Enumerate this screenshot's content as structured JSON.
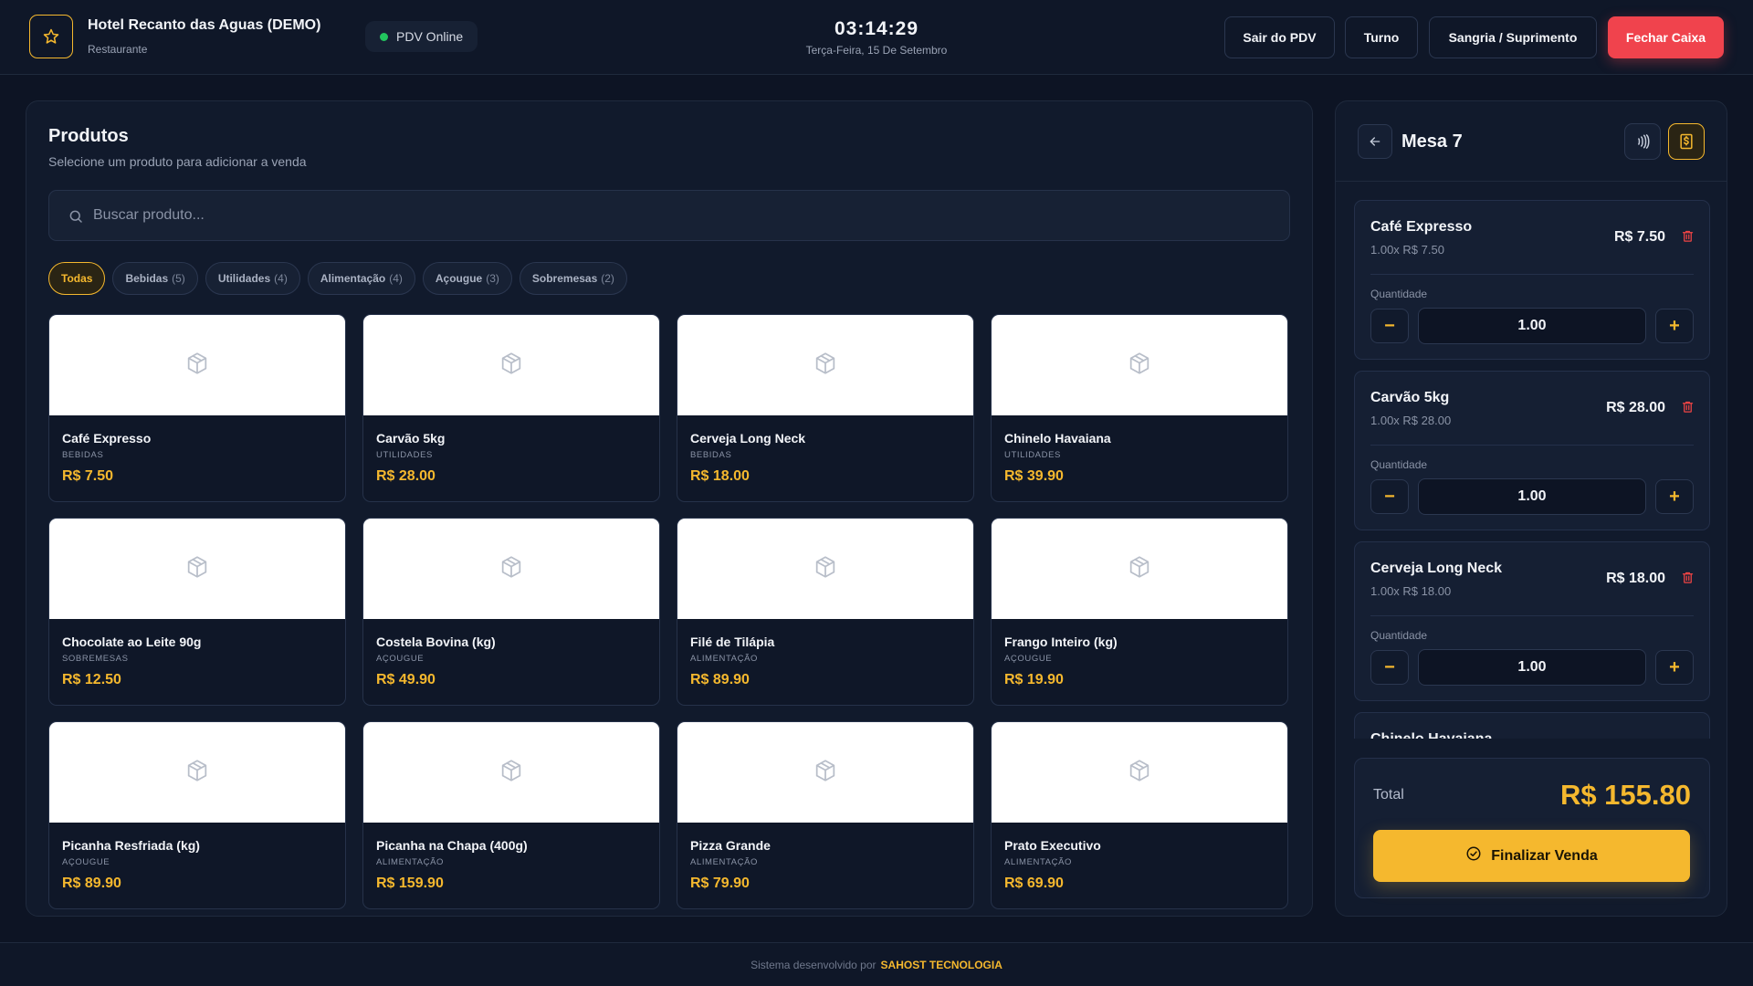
{
  "header": {
    "hotel_name": "Hotel Recanto das Aguas (DEMO)",
    "hotel_type": "Restaurante",
    "status": "PDV Online",
    "time": "03:14:29",
    "date": "Terça-Feira, 15 De Setembro",
    "buttons": {
      "exit": "Sair do PDV",
      "shift": "Turno",
      "cash_move": "Sangria / Suprimento",
      "close_cash": "Fechar Caixa"
    }
  },
  "products": {
    "title": "Produtos",
    "subtitle": "Selecione um produto para adicionar a venda",
    "search_placeholder": "Buscar produto...",
    "categories": [
      {
        "label": "Todas",
        "count": ""
      },
      {
        "label": "Bebidas",
        "count": "(5)"
      },
      {
        "label": "Utilidades",
        "count": "(4)"
      },
      {
        "label": "Alimentação",
        "count": "(4)"
      },
      {
        "label": "Açougue",
        "count": "(3)"
      },
      {
        "label": "Sobremesas",
        "count": "(2)"
      }
    ],
    "items": [
      {
        "name": "Café Expresso",
        "category": "BEBIDAS",
        "price": "R$ 7.50"
      },
      {
        "name": "Carvão 5kg",
        "category": "UTILIDADES",
        "price": "R$ 28.00"
      },
      {
        "name": "Cerveja Long Neck",
        "category": "BEBIDAS",
        "price": "R$ 18.00"
      },
      {
        "name": "Chinelo Havaiana",
        "category": "UTILIDADES",
        "price": "R$ 39.90"
      },
      {
        "name": "Chocolate ao Leite 90g",
        "category": "SOBREMESAS",
        "price": "R$ 12.50"
      },
      {
        "name": "Costela Bovina (kg)",
        "category": "AÇOUGUE",
        "price": "R$ 49.90"
      },
      {
        "name": "Filé de Tilápia",
        "category": "ALIMENTAÇÃO",
        "price": "R$ 89.90"
      },
      {
        "name": "Frango Inteiro (kg)",
        "category": "AÇOUGUE",
        "price": "R$ 19.90"
      },
      {
        "name": "Picanha Resfriada (kg)",
        "category": "AÇOUGUE",
        "price": "R$ 89.90"
      },
      {
        "name": "Picanha na Chapa (400g)",
        "category": "ALIMENTAÇÃO",
        "price": "R$ 159.90"
      },
      {
        "name": "Pizza Grande",
        "category": "ALIMENTAÇÃO",
        "price": "R$ 79.90"
      },
      {
        "name": "Prato Executivo",
        "category": "ALIMENTAÇÃO",
        "price": "R$ 69.90"
      }
    ]
  },
  "order": {
    "table": "Mesa 7",
    "qty_label": "Quantidade",
    "items": [
      {
        "name": "Café Expresso",
        "detail": "1.00x R$ 7.50",
        "total": "R$ 7.50",
        "qty": "1.00"
      },
      {
        "name": "Carvão 5kg",
        "detail": "1.00x R$ 28.00",
        "total": "R$ 28.00",
        "qty": "1.00"
      },
      {
        "name": "Cerveja Long Neck",
        "detail": "1.00x R$ 18.00",
        "total": "R$ 18.00",
        "qty": "1.00"
      },
      {
        "name": "Chinelo Havaiana",
        "detail": "",
        "total": "",
        "qty": ""
      }
    ],
    "total_label": "Total",
    "total_value": "R$ 155.80",
    "finalize_label": "Finalizar Venda"
  },
  "footer": {
    "text": "Sistema desenvolvido por",
    "brand": "SAHOST TECNOLOGIA"
  },
  "colors": {
    "accent": "#f5b82e",
    "danger": "#f0434d",
    "online": "#22c55e",
    "background": "#0d1424"
  }
}
